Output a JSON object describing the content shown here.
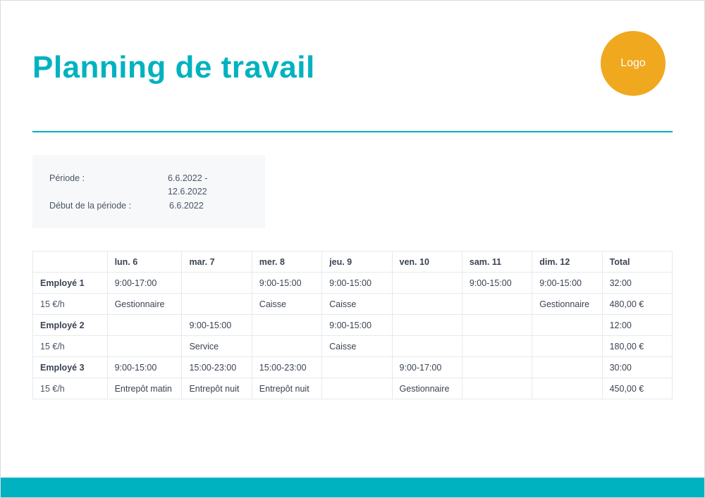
{
  "header": {
    "title": "Planning de travail",
    "logo_text": "Logo"
  },
  "info": {
    "period_label": "Période :",
    "period_value": "6.6.2022  -  12.6.2022",
    "start_label": "Début de la période :",
    "start_value": "6.6.2022"
  },
  "table": {
    "headers": {
      "blank": "",
      "mon": "lun. 6",
      "tue": "mar. 7",
      "wed": "mer. 8",
      "thu": "jeu. 9",
      "fri": "ven. 10",
      "sat": "sam. 11",
      "sun": "dim. 12",
      "total": "Total"
    },
    "employees": [
      {
        "name": "Employé 1",
        "rate": "15 €/h",
        "hours": {
          "mon": "9:00-17:00",
          "tue": "",
          "wed": "9:00-15:00",
          "thu": "9:00-15:00",
          "fri": "",
          "sat": "9:00-15:00",
          "sun": "9:00-15:00",
          "total": "32:00"
        },
        "roles": {
          "mon": "Gestionnaire",
          "tue": "",
          "wed": "Caisse",
          "thu": "Caisse",
          "fri": "",
          "sat": "",
          "sun": "Gestionnaire",
          "total": "480,00 €"
        }
      },
      {
        "name": "Employé 2",
        "rate": "15 €/h",
        "hours": {
          "mon": "",
          "tue": "9:00-15:00",
          "wed": "",
          "thu": "9:00-15:00",
          "fri": "",
          "sat": "",
          "sun": "",
          "total": "12:00"
        },
        "roles": {
          "mon": "",
          "tue": "Service",
          "wed": "",
          "thu": "Caisse",
          "fri": "",
          "sat": "",
          "sun": "",
          "total": "180,00 €"
        }
      },
      {
        "name": "Employé 3",
        "rate": "15 €/h",
        "hours": {
          "mon": "9:00-15:00",
          "tue": "15:00-23:00",
          "wed": "15:00-23:00",
          "thu": "",
          "fri": "9:00-17:00",
          "sat": "",
          "sun": "",
          "total": "30:00"
        },
        "roles": {
          "mon": "Entrepôt matin",
          "tue": "Entrepôt nuit",
          "wed": "Entrepôt nuit",
          "thu": "",
          "fri": "Gestionnaire",
          "sat": "",
          "sun": "",
          "total": "450,00 €"
        }
      }
    ]
  }
}
